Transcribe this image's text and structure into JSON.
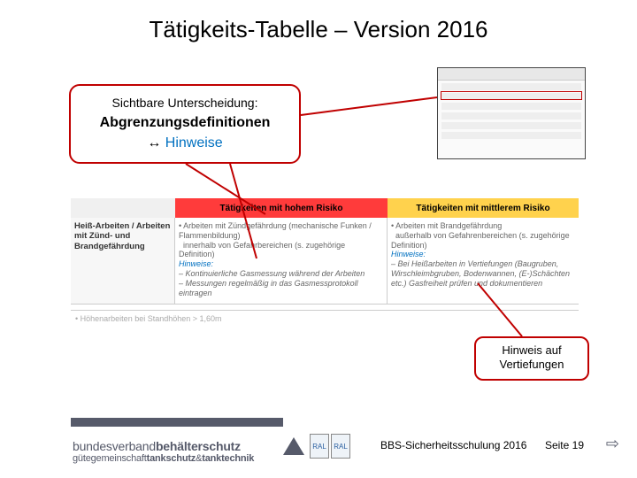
{
  "title": "Tätigkeits-Tabelle – Version 2016",
  "callout1": {
    "line1": "Sichtbare Unterscheidung:",
    "line2": "Abgrenzungsdefinitionen",
    "arrow": "↔",
    "line3_word": "Hinweise"
  },
  "callout2": {
    "text": "Hinweis auf Vertiefungen"
  },
  "bg_table": {
    "head_red": "Tätigkeiten mit hohem Risiko",
    "head_yellow": "Tätigkeiten mit mittlerem Risiko",
    "row_label": "Heiß-Arbeiten / Arbeiten mit Zünd- und Brandgefährdung",
    "col2_bullet": "Arbeiten mit Zündgefährdung (mechanische Funken / Flammenbildung)",
    "col2_sub": "innerhalb von Gefahrbereichen (s. zugehörige Definition)",
    "col2_hinw_label": "Hinweise:",
    "col2_hinw1": "– Kontinuierliche Gasmessung während der Arbeiten",
    "col2_hinw2": "– Messungen regelmäßig in das Gasmessprotokoll eintragen",
    "col3_bullet": "Arbeiten mit Brandgefährdung",
    "col3_sub": "außerhalb von Gefahrenbereichen (s. zugehörige Definition)",
    "col3_hinw_label": "Hinweise:",
    "col3_hinw1": "– Bei Heißarbeiten in Vertiefungen (Baugruben, Wirschleimbgruben, Bodenwannen, (E-)Schächten etc.) Gasfreiheit prüfen und dokumentieren",
    "below_row": "• Höhenarbeiten bei Standhöhen > 1,60m"
  },
  "footer": {
    "logo_line1_a": "bundesverband",
    "logo_line1_b": "behälterschutz",
    "logo_line2_a": "gütegemeinschaft",
    "logo_line2_b": "tankschutz",
    "logo_line2_amp": "&",
    "logo_line2_c": "tanktechnik",
    "badge1": "RAL",
    "badge2": "RAL",
    "training_label": "BBS-Sicherheitsschulung 2016",
    "page_label": "Seite 19"
  }
}
